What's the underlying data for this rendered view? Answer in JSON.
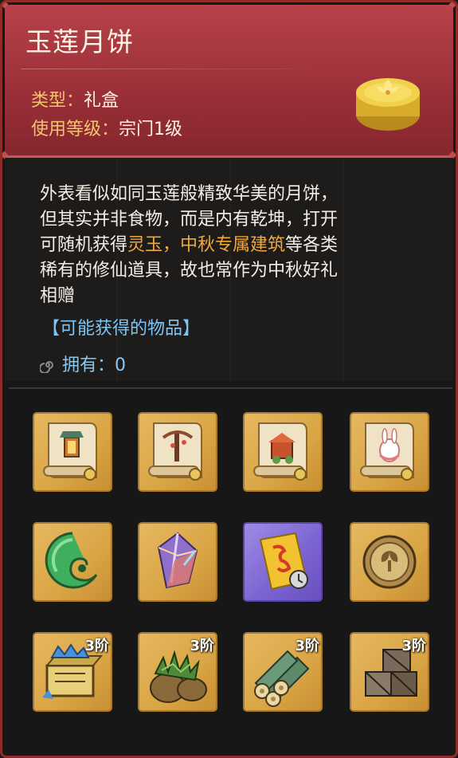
{
  "item": {
    "name": "玉莲月饼",
    "type_key": "类型：",
    "type_value": "礼盒",
    "level_key": "使用等级：",
    "level_value": "宗门1级",
    "description": {
      "line1": "外表看似如同玉莲般精致华美的月饼，",
      "line2": "但其实并非食物，而是内有乾坤，打开",
      "line3_pre": "可随机获得",
      "line3_hl1": "灵玉，",
      "line3_hl2": "中秋专属建筑",
      "line3_post": "等各类",
      "line4": "稀有的修仙道具，故也常作为中秋好礼",
      "line5": "相赠"
    },
    "possible_label": "【可能获得的物品】",
    "own_label": "拥有：",
    "own_count": "0"
  },
  "rewards": [
    {
      "icon": "scroll-lantern-icon",
      "tier": ""
    },
    {
      "icon": "scroll-tree-icon",
      "tier": ""
    },
    {
      "icon": "scroll-shrine-icon",
      "tier": ""
    },
    {
      "icon": "scroll-rabbit-icon",
      "tier": ""
    },
    {
      "icon": "jade-icon",
      "tier": ""
    },
    {
      "icon": "crystal-icon",
      "tier": ""
    },
    {
      "icon": "talisman-icon",
      "tier": ""
    },
    {
      "icon": "coin-icon",
      "tier": ""
    },
    {
      "icon": "ore-chest-icon",
      "tier": "3阶"
    },
    {
      "icon": "herb-sack-icon",
      "tier": "3阶"
    },
    {
      "icon": "wood-logs-icon",
      "tier": "3阶"
    },
    {
      "icon": "crates-icon",
      "tier": "3阶"
    }
  ],
  "colors": {
    "header": "#9c3039",
    "highlight": "#f2a93a",
    "link": "#7cc5f4",
    "item_gold": "#d9a545",
    "item_purple": "#7a62d0"
  }
}
